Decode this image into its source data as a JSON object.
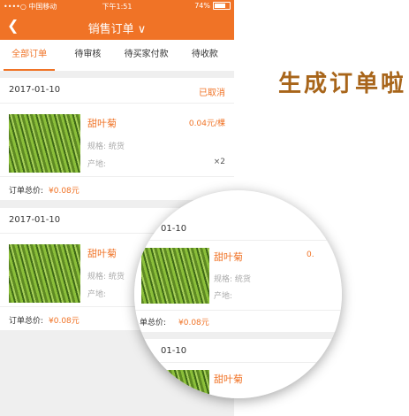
{
  "status_bar": {
    "carrier": "••••○ 中国移动",
    "time": "下午1:51",
    "battery": "74%"
  },
  "nav": {
    "back_icon": "chevron-left-icon",
    "title": "销售订单 ∨"
  },
  "tabs": [
    {
      "label": "全部订单",
      "active": true
    },
    {
      "label": "待审核"
    },
    {
      "label": "待买家付款"
    },
    {
      "label": "待收款"
    }
  ],
  "orders": [
    {
      "date": "2017-01-10",
      "status": "已取消",
      "product": "甜叶菊",
      "price": "0.04元/棵",
      "spec": "规格: 统货",
      "origin": "产地:",
      "qty": "×2",
      "total_label": "订单总价:",
      "total": "¥0.08元"
    },
    {
      "date": "2017-01-10",
      "status": "",
      "product": "甜叶菊",
      "price": "",
      "spec": "规格: 统货",
      "origin": "产地:",
      "qty": "",
      "total_label": "订单总价:",
      "total": "¥0.08元"
    }
  ],
  "headline": "生成订单啦!",
  "magnifier": {
    "date_partial": "01-10",
    "product": "甜叶菊",
    "price_partial": "0.",
    "spec": "规格: 统货",
    "origin": "产地:",
    "total_label_partial": "单总价:",
    "total": "¥0.08元",
    "date_partial_2": "01-10",
    "product_partial": "甜叶菊"
  },
  "colors": {
    "accent": "#f07326",
    "headline": "#a8651a"
  }
}
